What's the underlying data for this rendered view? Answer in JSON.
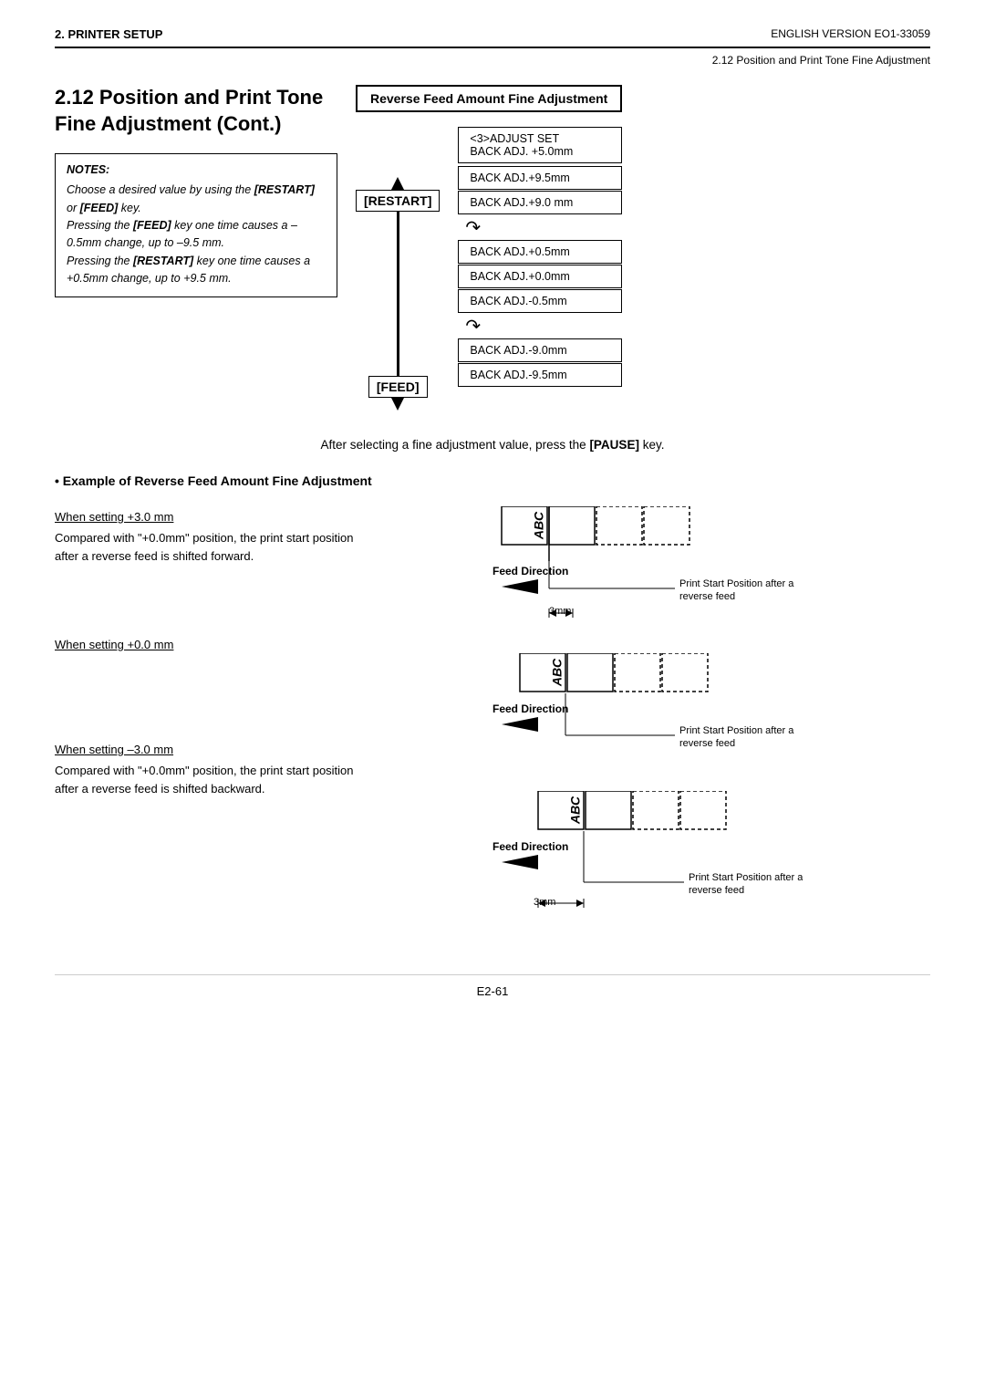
{
  "header": {
    "left": "2. PRINTER SETUP",
    "right_top": "ENGLISH VERSION EO1-33059",
    "right_sub": "2.12 Position and Print Tone Fine Adjustment"
  },
  "section_title": "2.12  Position and Print Tone Fine Adjustment (Cont.)",
  "reverse_feed_title": "Reverse Feed Amount Fine Adjustment",
  "notes": {
    "title": "NOTES:",
    "lines": [
      "Choose a desired value by using the [RESTART] or [FEED] key.",
      "Pressing the [FEED] key one time causes a –0.5mm change, up to –9.5 mm.",
      "Pressing the [RESTART] key one time causes a +0.5mm change, up to +9.5 mm."
    ]
  },
  "keys": {
    "restart": "[RESTART]",
    "feed": "[FEED]"
  },
  "adj_boxes": {
    "top_label": "<3>ADJUST SET",
    "top_value": "BACK ADJ. +5.0mm",
    "rows": [
      "BACK ADJ.+9.5mm",
      "BACK ADJ.+9.0 mm",
      "BACK ADJ.+0.5mm",
      "BACK ADJ.+0.0mm",
      "BACK ADJ.-0.5mm",
      "BACK ADJ.-9.0mm",
      "BACK ADJ.-9.5mm"
    ]
  },
  "pause_text": "After selecting a fine adjustment value, press the [PAUSE] key.",
  "example_title": "• Example of Reverse Feed Amount Fine Adjustment",
  "settings": [
    {
      "label": "When setting +3.0 mm",
      "desc": "Compared with \"+0.0mm\" position, the print start position after a reverse feed is shifted forward.",
      "feed_dir": "Feed Direction",
      "print_start": "Print Start Position after a reverse feed",
      "dim": "3mm"
    },
    {
      "label": "When setting +0.0 mm",
      "desc": "",
      "feed_dir": "Feed Direction",
      "print_start": "Print Start Position after a reverse feed",
      "dim": ""
    },
    {
      "label": "When setting –3.0 mm",
      "desc": "Compared with \"+0.0mm\" position, the print start position after a reverse feed is shifted backward.",
      "feed_dir": "Feed Direction",
      "print_start": "Print Start Position after a reverse feed",
      "dim": "3mm"
    }
  ],
  "footer": "E2-61"
}
